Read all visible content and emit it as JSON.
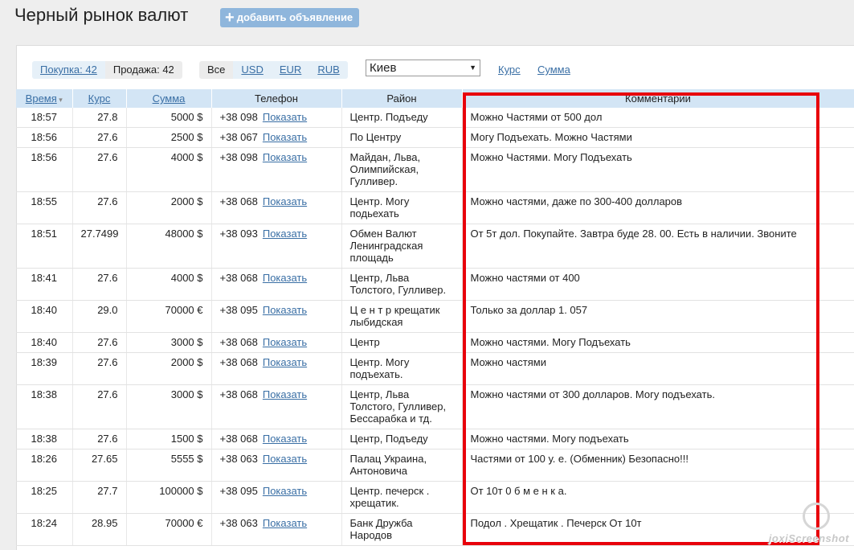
{
  "page_title": "Черный рынок валют",
  "add_button": "добавить объявление",
  "tabs": {
    "buy": "Покупка: 42",
    "sell": "Продажа: 42"
  },
  "currencies": [
    "Все",
    "USD",
    "EUR",
    "RUB"
  ],
  "city": "Киев",
  "links": {
    "rate": "Курс",
    "sum": "Сумма"
  },
  "columns": {
    "time": "Время",
    "rate": "Курс",
    "sum": "Сумма",
    "phone": "Телефон",
    "district": "Район",
    "comments": "Комментарии"
  },
  "show_label": "Показать",
  "rows": [
    {
      "time": "18:57",
      "rate": "27.8",
      "sum": "5000 $",
      "phone": "+38 098",
      "district": "Центр. Подъеду",
      "comment": "Можно Частями от 500 дол"
    },
    {
      "time": "18:56",
      "rate": "27.6",
      "sum": "2500 $",
      "phone": "+38 067",
      "district": "По Центру",
      "comment": "Могу Подъехать. Можно Частями"
    },
    {
      "time": "18:56",
      "rate": "27.6",
      "sum": "4000 $",
      "phone": "+38 098",
      "district": "Майдан, Льва, Олимпийская, Гулливер.",
      "comment": "Можно Частями. Могу Подъехать"
    },
    {
      "time": "18:55",
      "rate": "27.6",
      "sum": "2000 $",
      "phone": "+38 068",
      "district": "Центр. Могу подьехать",
      "comment": "Можно частями, даже по 300-400 долларов"
    },
    {
      "time": "18:51",
      "rate": "27.7499",
      "sum": "48000 $",
      "phone": "+38 093",
      "district": "Обмен Валют Ленинградская площадь",
      "comment": "От 5т дол. Покупайте. Завтра буде 28. 00. Есть в наличии. Звоните"
    },
    {
      "time": "18:41",
      "rate": "27.6",
      "sum": "4000 $",
      "phone": "+38 068",
      "district": "Центр, Льва Толстого, Гулливер.",
      "comment": "Можно частями от 400"
    },
    {
      "time": "18:40",
      "rate": "29.0",
      "sum": "70000 €",
      "phone": "+38 095",
      "district": "Ц е н т р крещатик лыбидская",
      "comment": "Только за доллар 1. 057"
    },
    {
      "time": "18:40",
      "rate": "27.6",
      "sum": "3000 $",
      "phone": "+38 068",
      "district": "Центр",
      "comment": "Можно частями. Могу Подъехать"
    },
    {
      "time": "18:39",
      "rate": "27.6",
      "sum": "2000 $",
      "phone": "+38 068",
      "district": "Центр. Могу подъехать.",
      "comment": "Можно частями"
    },
    {
      "time": "18:38",
      "rate": "27.6",
      "sum": "3000 $",
      "phone": "+38 068",
      "district": "Центр, Льва Толстого, Гулливер, Бессарабка и тд.",
      "comment": "Можно частями от 300 долларов. Могу подъехать."
    },
    {
      "time": "18:38",
      "rate": "27.6",
      "sum": "1500 $",
      "phone": "+38 068",
      "district": "Центр, Подъеду",
      "comment": "Можно частями. Могу подъехать"
    },
    {
      "time": "18:26",
      "rate": "27.65",
      "sum": "5555 $",
      "phone": "+38 063",
      "district": "Палац Украина, Антоновича",
      "comment": "Частями от 100 у. е. (Обменник) Безопасно!!!"
    },
    {
      "time": "18:25",
      "rate": "27.7",
      "sum": "100000 $",
      "phone": "+38 095",
      "district": "Центр. печерск . хрещатик.",
      "comment": "От 10т 0 б м е н к а."
    },
    {
      "time": "18:24",
      "rate": "28.95",
      "sum": "70000 €",
      "phone": "+38 063",
      "district": "Банк Дружба Народов",
      "comment": "Подол . Хрещатик . Печерск От 10т"
    }
  ],
  "watermark": "joxiScreenshot"
}
